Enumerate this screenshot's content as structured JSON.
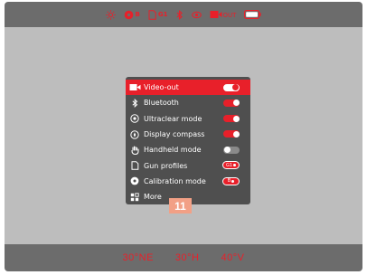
{
  "status_bar": {
    "icons": [
      "brightness-icon",
      "calibration-icon",
      "gun-profile-icon",
      "bluetooth-icon",
      "ultraclear-icon",
      "video-out-icon",
      "battery-icon"
    ],
    "calibration_label": "B",
    "gun_profile_label": "G1",
    "video_out_sub": "OUT"
  },
  "menu": {
    "items": [
      {
        "label": "Video-out",
        "icon": "video-out-icon",
        "control": "toggle",
        "state": "on",
        "selected": true
      },
      {
        "label": "Bluetooth",
        "icon": "bluetooth-icon",
        "control": "toggle",
        "state": "on"
      },
      {
        "label": "Ultraclear mode",
        "icon": "eye-icon",
        "control": "toggle",
        "state": "on"
      },
      {
        "label": "Display compass",
        "icon": "compass-icon",
        "control": "toggle",
        "state": "on"
      },
      {
        "label": "Handheld mode",
        "icon": "hand-icon",
        "control": "toggle",
        "state": "off"
      },
      {
        "label": "Gun profiles",
        "icon": "gun-profile-icon",
        "control": "pill",
        "value": "G1"
      },
      {
        "label": "Calibration mode",
        "icon": "calibration-icon",
        "control": "pill",
        "value": "B"
      },
      {
        "label": "More",
        "icon": "more-icon",
        "control": "none"
      }
    ]
  },
  "badge": "11",
  "readouts": {
    "bearing": "30°NE",
    "horizontal": "30°H",
    "vertical": "40°V"
  },
  "colors": {
    "accent": "#e8202a",
    "frame": "#6c6c6c",
    "screen": "#bdbdbd",
    "menu_bg": "#4f4f4f",
    "badge": "#f2a086"
  }
}
